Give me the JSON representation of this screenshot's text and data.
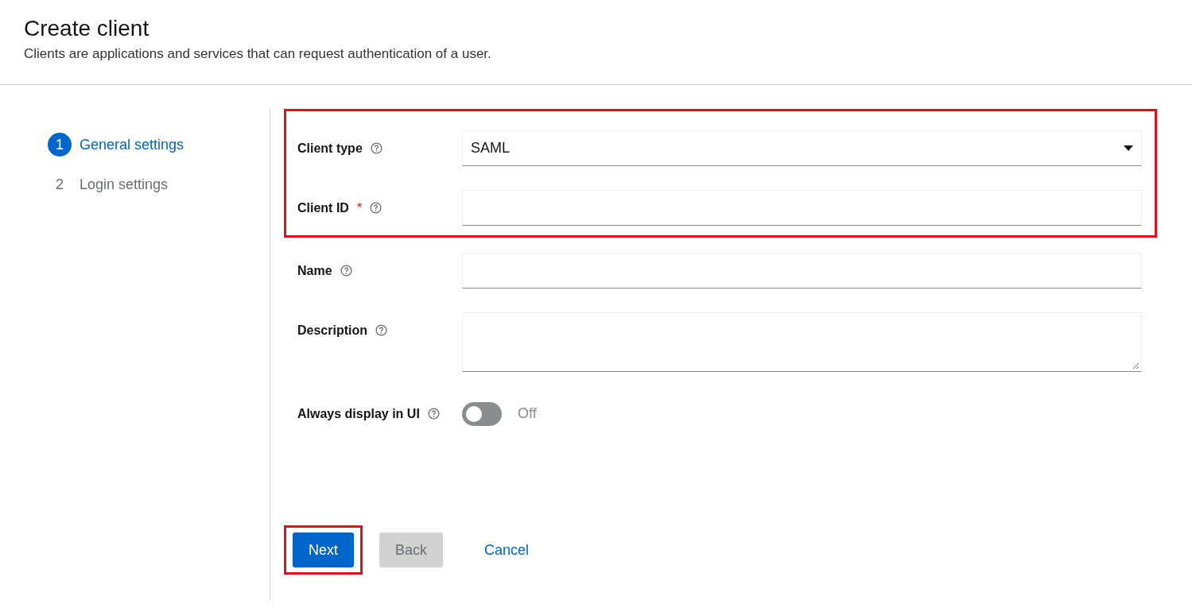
{
  "header": {
    "title": "Create client",
    "subtitle": "Clients are applications and services that can request authentication of a user."
  },
  "steps": [
    {
      "number": "1",
      "label": "General settings",
      "selected": true
    },
    {
      "number": "2",
      "label": "Login settings",
      "selected": false
    }
  ],
  "form": {
    "sections": [
      {
        "highlighted": true,
        "fields": [
          {
            "kind": "select",
            "label": "Client type",
            "value": "SAML"
          },
          {
            "kind": "text",
            "label": "Client ID",
            "required_marker": "*"
          }
        ]
      },
      {
        "highlighted": false,
        "fields": [
          {
            "kind": "text",
            "label": "Name"
          },
          {
            "kind": "textarea",
            "label": "Description"
          },
          {
            "kind": "switch",
            "label": "Always display in UI",
            "on": false,
            "state_label": "Off"
          }
        ]
      }
    ]
  },
  "buttons": [
    {
      "kind": "primary",
      "label": "Next",
      "disabled": false,
      "highlighted": true
    },
    {
      "kind": "secondary",
      "label": "Back",
      "disabled": true,
      "highlighted": false
    },
    {
      "kind": "link",
      "label": "Cancel",
      "disabled": false,
      "highlighted": false
    }
  ]
}
